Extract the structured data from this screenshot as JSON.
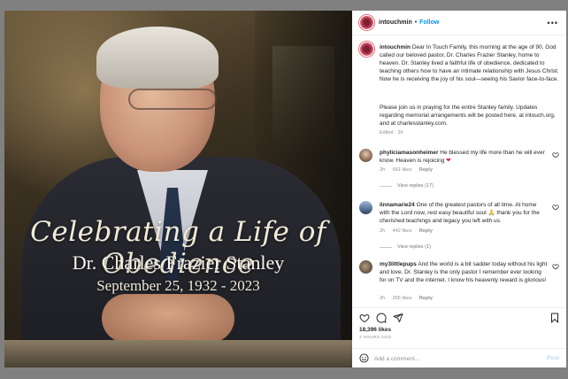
{
  "post": {
    "username": "intouchmin",
    "follow_label": "Follow",
    "dot": "•",
    "more": "•••",
    "image": {
      "script_title": "Celebrating a Life of Obedience",
      "name": "Dr. Charles Frazier Stanley",
      "dates": "September 25, 1932 - 2023"
    },
    "caption": {
      "username": "intouchmin",
      "paragraph1": "Dear In Touch Family, this morning at the age of 90, God called our beloved pastor, Dr. Charles Frazier Stanley, home to heaven. Dr. Stanley lived a faithful life of obedience, dedicated to teaching others how to have an intimate relationship with Jesus Christ. Now he is receiving the joy of his soul—seeing his Savior face-to-face.",
      "paragraph2": "Please join us in praying for the entire Stanley family. Updates regarding memorial arrangements will be posted here, at intouch.org, and at charlesstanley.com.",
      "meta": "Edited · 2h"
    },
    "comments": [
      {
        "username": "phyliciamasonheimer",
        "text": "He blessed my life more than he will ever know. Heaven is rejoicing",
        "emoji": "❤",
        "time": "2h",
        "likes": "661 likes",
        "reply": "Reply",
        "view_replies": "View replies (17)"
      },
      {
        "username": "linnamarie24",
        "text": "One of the greatest pastors of all time. At home with the Lord now, rest easy beautiful soul 🙏 thank you for the cherished teachings and legacy you left with us.",
        "time": "2h",
        "likes": "442 likes",
        "reply": "Reply",
        "view_replies": "View replies (1)"
      },
      {
        "username": "my3littlepups",
        "text": "And the world is a bit sadder today without his light and love. Dr. Stanley is the only pastor I remember ever looking for on TV and the internet. I know his heavenly reward is glorious!",
        "time": "2h",
        "likes": "266 likes",
        "reply": "Reply"
      }
    ],
    "likes_count": "18,396 likes",
    "time_ago": "2 HOURS AGO",
    "comment_placeholder": "Add a comment...",
    "post_label": "Post"
  },
  "colors": {
    "follow": "#0095f6",
    "post_disabled": "#b3dbff",
    "heart": "#e0245e"
  },
  "icons": [
    "heart-icon",
    "comment-icon",
    "share-icon",
    "bookmark-icon",
    "smiley-icon",
    "more-icon"
  ]
}
